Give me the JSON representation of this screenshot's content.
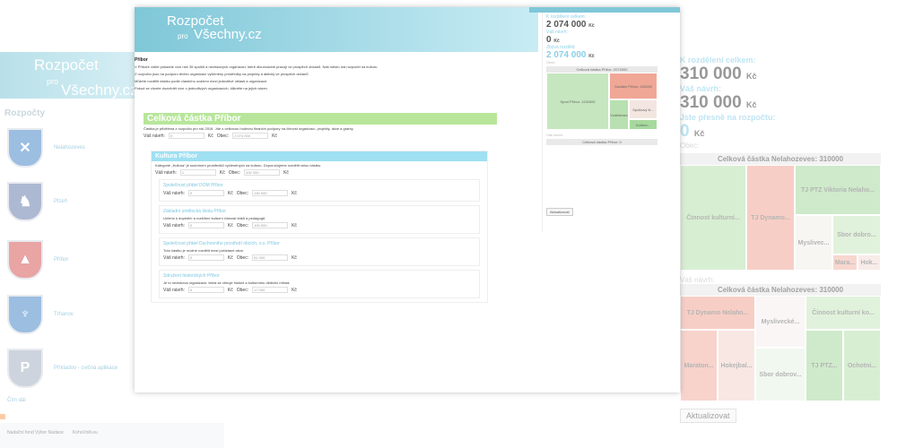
{
  "background": {
    "logo": {
      "line1": "Rozpočet",
      "line2": "pro",
      "line3": "Všechny.cz"
    },
    "sidebar": {
      "title": "Rozpočty",
      "items": [
        {
          "label": "Nelahozeves",
          "color": "#4a89c8",
          "symbol": "✕"
        },
        {
          "label": "Plzeň",
          "color": "#6a7fb0",
          "symbol": "♞"
        },
        {
          "label": "Příbor",
          "color": "#d85a5a",
          "symbol": "▲"
        },
        {
          "label": "Trhanov",
          "color": "#4a89c8",
          "symbol": "♆"
        },
        {
          "label": "Příkladov - cvičná aplikace",
          "color": "#a7b1c2",
          "symbol": "P"
        }
      ],
      "footer_link": "Čím dál"
    },
    "footer_logos": [
      "Nadační fond Výbor Nadace",
      "KohoVolit.eu"
    ],
    "summary": {
      "total_label": "K rozdělení celkem:",
      "total_value": "310 000",
      "currency": "Kč",
      "proposal_label": "Váš návrh:",
      "proposal_value": "310 000",
      "exact_label": "Jste přesně na rozpočtu:",
      "exact_value": "0",
      "obec_label": "Obec:",
      "chart1_title": "Celková částka Nelahozeves: 310000",
      "chart1_items": [
        {
          "label": "Činnost kulturní...",
          "color": "#b8e0b0"
        },
        {
          "label": "TJ Dynamo...",
          "color": "#f0a796"
        },
        {
          "label": "TJ PTZ Viktoria Nelaho...",
          "color": "#a6d99e"
        },
        {
          "label": "Myslivec...",
          "color": "#f3efe8"
        },
        {
          "label": "Sbor dobro...",
          "color": "#c8e8c0"
        },
        {
          "label": "Mara...",
          "color": "#f0b6a8"
        },
        {
          "label": "Hok...",
          "color": "#f3ddd8"
        }
      ],
      "chart2_title_label": "Váš návrh:",
      "chart2_title": "Celková částka Nelahozeves: 310000",
      "chart2_items": [
        {
          "label": "TJ Dynamo Nelaho...",
          "color": "#f0a796"
        },
        {
          "label": "Myslivecké...",
          "color": "#f6efef"
        },
        {
          "label": "Činnost kulturní ko...",
          "color": "#c8e8c0"
        },
        {
          "label": "Maraton...",
          "color": "#f0b0a0"
        },
        {
          "label": "Hokejbal...",
          "color": "#f3d4cc"
        },
        {
          "label": "Sbor dobrov...",
          "color": "#e6f3e3"
        },
        {
          "label": "TJ PTZ...",
          "color": "#a6d99e"
        },
        {
          "label": "Ochotni...",
          "color": "#b8e0b0"
        }
      ],
      "refresh_button": "Aktualizovat"
    }
  },
  "modal": {
    "logo": {
      "line1": "Rozpočet",
      "line2": "pro",
      "line3": "Všechny.cz"
    },
    "intro_title": "Příbor",
    "intro_paragraphs": [
      "V Příboře vidíte pokaždé více než 35 spolků a neziskových organizací, které dlouhodobě pracují ve prospěch občanů. Náš město má rozpočet na kulturu.",
      "Z rozpočtu jsou na podporu těchto organizací vyčleněny prostředky na projekty a aktivity ve prospěch občanů.",
      "Můžete rozdělit částku podle vlastního uvážení mezi jednotlivé oblasti a organizace.",
      "Pokud se chcete dozvědět více o jednotlivých organizacích, klikněte na jejich název."
    ],
    "total": {
      "title": "Celková částka Příbor",
      "desc": "Částka je přidělena z rozpočtu pro rok 2016. Jde o celkovou hodnotu finanční podpory na činnost organizací, projekty, akce a granty.",
      "proposal_label": "Váš návrh:",
      "proposal_value": "0",
      "currency": "Kč",
      "obec_label": "Obec:",
      "obec_value": "2 074 000"
    },
    "kultura": {
      "title": "Kultura Příbor",
      "desc": "Kategorie „Kultura“ je souhrnem prostředků vyčleněných na kulturu. Doporučujeme rozdělit celou částku.",
      "proposal_label": "Váš návrh:",
      "proposal_value": "1",
      "obec_label": "Obec:",
      "obec_value": "432 000",
      "currency": "Kč",
      "subs": [
        {
          "title": "Společnost přátel DOM Příbor",
          "desc": "",
          "value": "0",
          "obec": "140 000"
        },
        {
          "title": "Základní umělecká škola Příbor",
          "desc": "Určeno k doplnění a rozšíření kulturní činnosti žáků a pedagogů.",
          "value": "0",
          "obec": "100 000"
        },
        {
          "title": "Společnost přátel Duchovního prostředí obcích, o.s. Příbor",
          "desc": "Tuto částku je možné rozdělit mezi pořádané akce.",
          "value": "0",
          "obec": "51 000"
        },
        {
          "title": "Sdružení historických Příbor",
          "desc": "Je to nezisková organizace, která se věnuje historii a kulturnímu dědictví města.",
          "value": "0",
          "obec": "17 000"
        }
      ]
    },
    "right": {
      "total_label": "K rozdělení celkem:",
      "total_value": "2 074 000",
      "currency": "Kč",
      "proposal_label": "Váš návrh:",
      "proposal_value": "0",
      "remaining_label": "Zbývá rozdělit:",
      "remaining_value": "2 074 000",
      "obec_label": "Obec:",
      "chart_title": "Celková částka Příbor: 2074000",
      "chart_items": [
        {
          "label": "Sport Příbor: 1130000",
          "color": "#c5e6bf"
        },
        {
          "label": "Sociální Příbor: 432000",
          "color": "#f0a796"
        },
        {
          "label": "Vzdělávání",
          "color": "#b8e0b0"
        },
        {
          "label": "Spolkový ži...",
          "color": "#f3e6e0"
        },
        {
          "label": "Kultura...",
          "color": "#a6d99e"
        }
      ],
      "proposal_chart_label": "Váš návrh:",
      "proposal_chart_title": "Celková částka Příbor: 0",
      "refresh_button": "Aktualizovat"
    }
  }
}
